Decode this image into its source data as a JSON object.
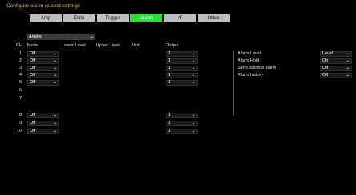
{
  "page_title": "Configure alarm related settings",
  "tabs": [
    {
      "label": "Amp"
    },
    {
      "label": "Data"
    },
    {
      "label": "Trigger"
    },
    {
      "label": "Alarm"
    },
    {
      "label": "I/F"
    },
    {
      "label": "Other"
    }
  ],
  "active_tab": "Alarm",
  "type_select": {
    "value": "Analog"
  },
  "table": {
    "headers": {
      "ch": "CH",
      "mode": "Mode",
      "lower": "Lower Level",
      "upper": "Upper Level",
      "unit": "Unit",
      "output": "Output"
    },
    "rows": [
      {
        "ch": "1",
        "mode": "Off",
        "output": "1"
      },
      {
        "ch": "2",
        "mode": "Off",
        "output": "1"
      },
      {
        "ch": "3",
        "mode": "Off",
        "output": "1"
      },
      {
        "ch": "4",
        "mode": "Off",
        "output": "1"
      },
      {
        "ch": "5",
        "mode": "Off",
        "output": "1"
      },
      {
        "ch": "6"
      },
      {
        "ch": "7"
      },
      {
        "ch": "8",
        "mode": "Off",
        "output": "1"
      },
      {
        "ch": "9",
        "mode": "Off",
        "output": "1"
      },
      {
        "ch": "10",
        "mode": "Off",
        "output": "1"
      }
    ]
  },
  "settings": [
    {
      "label": "Alarm Level",
      "value": "Level"
    },
    {
      "label": "Alarm Hold",
      "value": "On"
    },
    {
      "label": "Send burnout alarm",
      "value": "Off"
    },
    {
      "label": "Alarm history",
      "value": "Off"
    }
  ],
  "icons": {
    "dropdown_arrow": "chevron-down-icon"
  },
  "colors": {
    "title": "#d8b868",
    "active_tab": "#2edc3c",
    "tab": "#bdbdbd"
  }
}
